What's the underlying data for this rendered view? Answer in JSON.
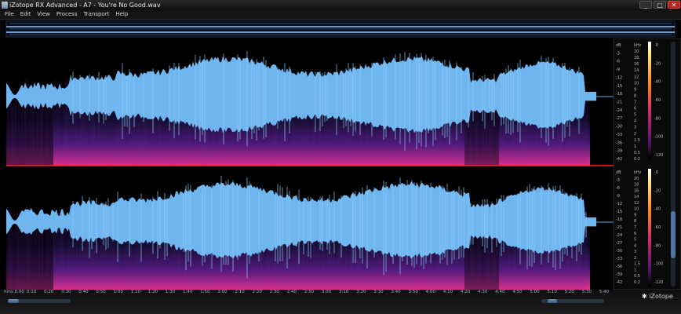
{
  "window": {
    "title": "iZotope RX Advanced - A7 - You're No Good.wav",
    "minimize": "_",
    "maximize": "□",
    "close": "✕"
  },
  "menu": [
    "File",
    "Edit",
    "View",
    "Process",
    "Transport",
    "Help"
  ],
  "scales": {
    "left_db": [
      "dB",
      "-3",
      "-6",
      "-9",
      "-12",
      "-15",
      "-18",
      "-21",
      "-24",
      "-27",
      "-30",
      "-33",
      "-36",
      "-39",
      "-42"
    ],
    "hz": [
      "kHz",
      "20",
      "18",
      "16",
      "14",
      "12",
      "10",
      "9",
      "8",
      "7",
      "6",
      "5",
      "4",
      "3",
      "2",
      "1.5",
      "1",
      "0.5",
      "0.2"
    ],
    "colorbar": [
      "-0",
      "-20",
      "-40",
      "-60",
      "-80",
      "-100",
      "-120"
    ]
  },
  "time_ruler": [
    "hms 0.00",
    "0:10",
    "0:20",
    "0:30",
    "0:40",
    "0:50",
    "1:00",
    "1:10",
    "1:20",
    "1:30",
    "1:40",
    "1:50",
    "2:00",
    "2:10",
    "2:20",
    "2:30",
    "2:40",
    "2:50",
    "3:00",
    "3:10",
    "3:20",
    "3:30",
    "3:40",
    "3:50",
    "4:00",
    "4:10",
    "4:20",
    "4:30",
    "4:40",
    "4:50",
    "5:00",
    "5:10",
    "5:20",
    "5:30",
    "5:40"
  ],
  "logo": {
    "mark": "✱",
    "text": "iZotope"
  },
  "colors": {
    "waveform": "#6fb6f0",
    "spectro_low": "#0b0b3a",
    "spectro_mid": "#6a1c8c",
    "spectro_high": "#e0308c",
    "divider": "#ff2020",
    "accent": "#4a78ad"
  }
}
